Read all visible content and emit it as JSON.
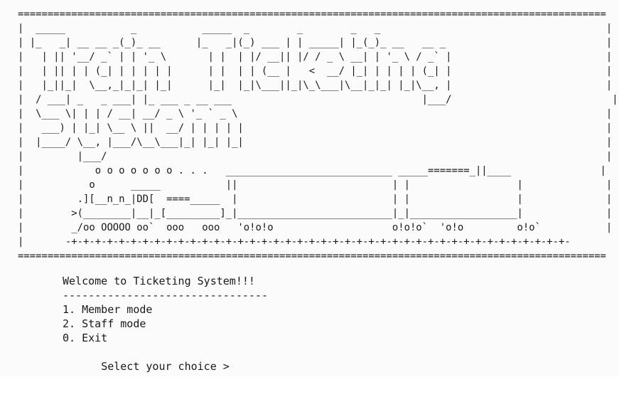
{
  "banner": {
    "title_art": "===================================================================================================\n|  _____           _           _____  _        _        _   _                                      |\n| |_   _| __ __ _(_)_ __      |_   _|(_) ___ | | _____| |_(_)_ __   __ _                           |\n|   | || '__/ _` | | '_ \\       | |  | |/ __|| |/ / _ \\ __| | '_ \\ / _` |                          |\n|   | || | | (_| | | | | |      | |  | | (__ |   <  __/ |_| | | | | (_| |                          |\n|   |_||_|  \\__,_|_|_| |_|      |_|  |_|\\___||_|\\_\\___|\\__|_|_| |_|\\__, |                          |\n|  / ___| _   _ ___| |_ ___ _ __ ___                                |___/                           |\n|  \\___ \\| | | / __| __/ _ \\ '_ ` _ \\                                                              |\n|   ___) | |_| \\__ \\ ||  __/ | | | | |                                                             |\n|  |____/ \\__, |___/\\__\\___|_| |_| |_|                                                             |\n|         |___/                                                                                    |\n|            o o o o o o o . . .   ____________________________ _____=======_||____               |\n|           o      _____           ||                          | |                  |              |\n|         .][__n_n_|DD[  ====_____  |                          | |                  |              |\n|        >(________|__|_[_________]_|__________________________|_|__________________|              |\n|        _/oo OOOOO oo`  ooo   ooo   'o!o!o                    o!o!o`  'o!o         o!o`           |\n|       -+-+-+-+-+-+-+-+-+-+-+-+-+-+-+-+-+-+-+-+-+-+-+-+-+-+-+-+-+-+-+-+-+-+-+-+-+-+-+-+-+-+-        |\n==================================================================================================="
  },
  "menu": {
    "welcome": "Welcome to Ticketing System!!!",
    "divider": "--------------------------------",
    "options": [
      "1. Member mode",
      "2. Staff mode",
      "0. Exit"
    ],
    "prompt": "Select your choice >"
  }
}
